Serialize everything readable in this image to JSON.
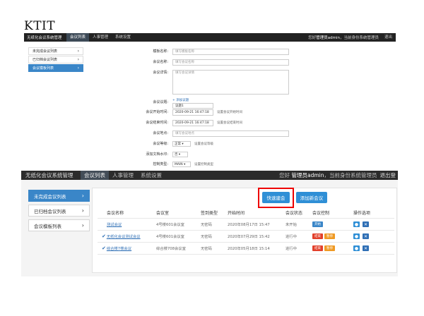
{
  "brand": "KTIT",
  "small": {
    "app_title": "无纸化会议系统管理",
    "nav": [
      "会议列表",
      "人事管理",
      "系统设置"
    ],
    "user_prefix": "您好",
    "user_name": "管理员admin",
    "user_suffix": "，当前身份系统管理员",
    "logout": "退出",
    "sidebar": [
      {
        "label": "未完成会议列表"
      },
      {
        "label": "已归档会议列表"
      },
      {
        "label": "会议模板列表"
      }
    ],
    "form": {
      "template_name": {
        "label": "模板名称:",
        "placeholder": "填写模板名称"
      },
      "meeting_name": {
        "label": "会议名称:",
        "placeholder": "填写会议名称"
      },
      "meeting_detail": {
        "label": "会议详情:",
        "placeholder": "填写会议详情"
      },
      "agenda": {
        "label": "会议议题:",
        "add_link": "+ 添加议题",
        "item": "议题1"
      },
      "start_time": {
        "label": "会议开始时间:",
        "value": "2020-09-21 16:47:18",
        "hint": "设置会议开始时间"
      },
      "end_time": {
        "label": "会议结束时间:",
        "value": "2020-09-21 16:47:18",
        "hint": "设置会议结束时间"
      },
      "location": {
        "label": "会议地点:",
        "placeholder": "填写会议地点"
      },
      "level": {
        "label": "会议等级:",
        "value": "正常",
        "hint": "设置会议等级"
      },
      "doc_level": {
        "label": "添加文档水印:",
        "value": "否"
      },
      "control": {
        "label": "控制类型:",
        "value": "MAIN",
        "hint": "设置控制类型"
      }
    }
  },
  "large": {
    "app_title": "无纸化会议系统管理",
    "nav": [
      "会议列表",
      "人事管理",
      "系统设置"
    ],
    "user_prefix": "您好",
    "user_name": "管理员admin",
    "user_suffix": "，当前身份系统管理员",
    "logout": "退出登",
    "sidebar": [
      {
        "label": "未完成会议列表"
      },
      {
        "label": "已归档会议列表"
      },
      {
        "label": "会议模板列表"
      }
    ],
    "quick_button": "快速建会",
    "add_button": "添加新会议",
    "columns": [
      "会议名称",
      "会议室",
      "签到类型",
      "开始时间",
      "会议状态",
      "会议控制",
      "操作选项"
    ],
    "rows": [
      {
        "name": "测试会议",
        "room": "4号楼601会议室",
        "sign": "无密码",
        "start": "2020年08月17日 15:47",
        "status": "未开始",
        "controls": [
          "开始"
        ]
      },
      {
        "name": "无纸化会议测试会议",
        "room": "4号楼601会议室",
        "sign": "无密码",
        "start": "2020年07月29日 15:42",
        "status": "进行中",
        "controls": [
          "结束",
          "暂停"
        ]
      },
      {
        "name": "综合楼7楼会议",
        "room": "综合楼708会议室",
        "sign": "无密码",
        "start": "2020年05月18日 15:14",
        "status": "进行中",
        "controls": [
          "结束",
          "暂停"
        ]
      }
    ]
  }
}
